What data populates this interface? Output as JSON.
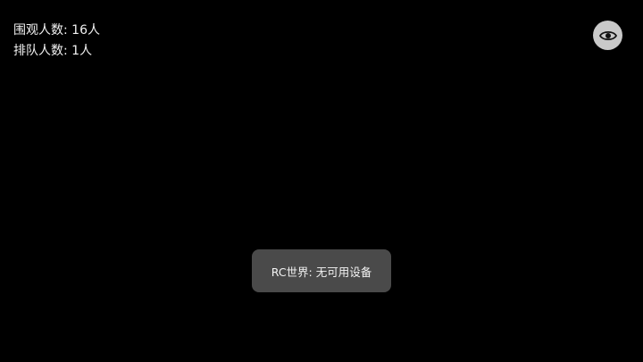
{
  "stats": {
    "viewers_label": "围观人数:",
    "viewers_value": "16人",
    "queue_label": "排队人数:",
    "queue_value": "1人"
  },
  "toolbar": {
    "visibility_icon": "eye-icon"
  },
  "toast": {
    "message": "RC世界: 无可用设备"
  },
  "colors": {
    "background": "#000000",
    "toast_bg": "#4a4a4a",
    "eye_button_bg": "#c9c9c9"
  }
}
